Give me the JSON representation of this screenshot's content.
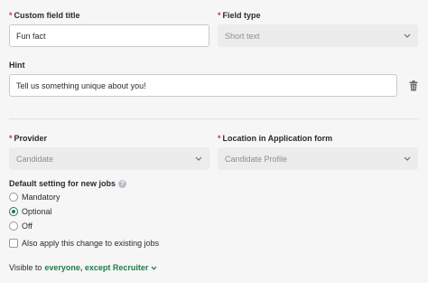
{
  "custom_field": {
    "title_label": "Custom field title",
    "title_value": "Fun fact",
    "type_label": "Field type",
    "type_value": "Short text"
  },
  "hint": {
    "label": "Hint",
    "value": "Tell us something unique about you!"
  },
  "provider": {
    "label": "Provider",
    "value": "Candidate"
  },
  "location": {
    "label": "Location in Application form",
    "value": "Candidate Profile"
  },
  "default_setting": {
    "label": "Default setting for new jobs",
    "help_glyph": "?",
    "options": [
      {
        "label": "Mandatory",
        "selected": false
      },
      {
        "label": "Optional",
        "selected": true
      },
      {
        "label": "Off",
        "selected": false
      }
    ],
    "apply_existing_label": "Also apply this change to existing jobs",
    "apply_existing_checked": false
  },
  "visibility": {
    "prefix": "Visible to",
    "value": "everyone, except Recruiter"
  },
  "icons": {
    "delete": "trash-icon",
    "chevron": "chevron-down-icon",
    "help": "help-icon"
  },
  "colors": {
    "required": "#d6343d",
    "accent": "#1f7a4d"
  }
}
